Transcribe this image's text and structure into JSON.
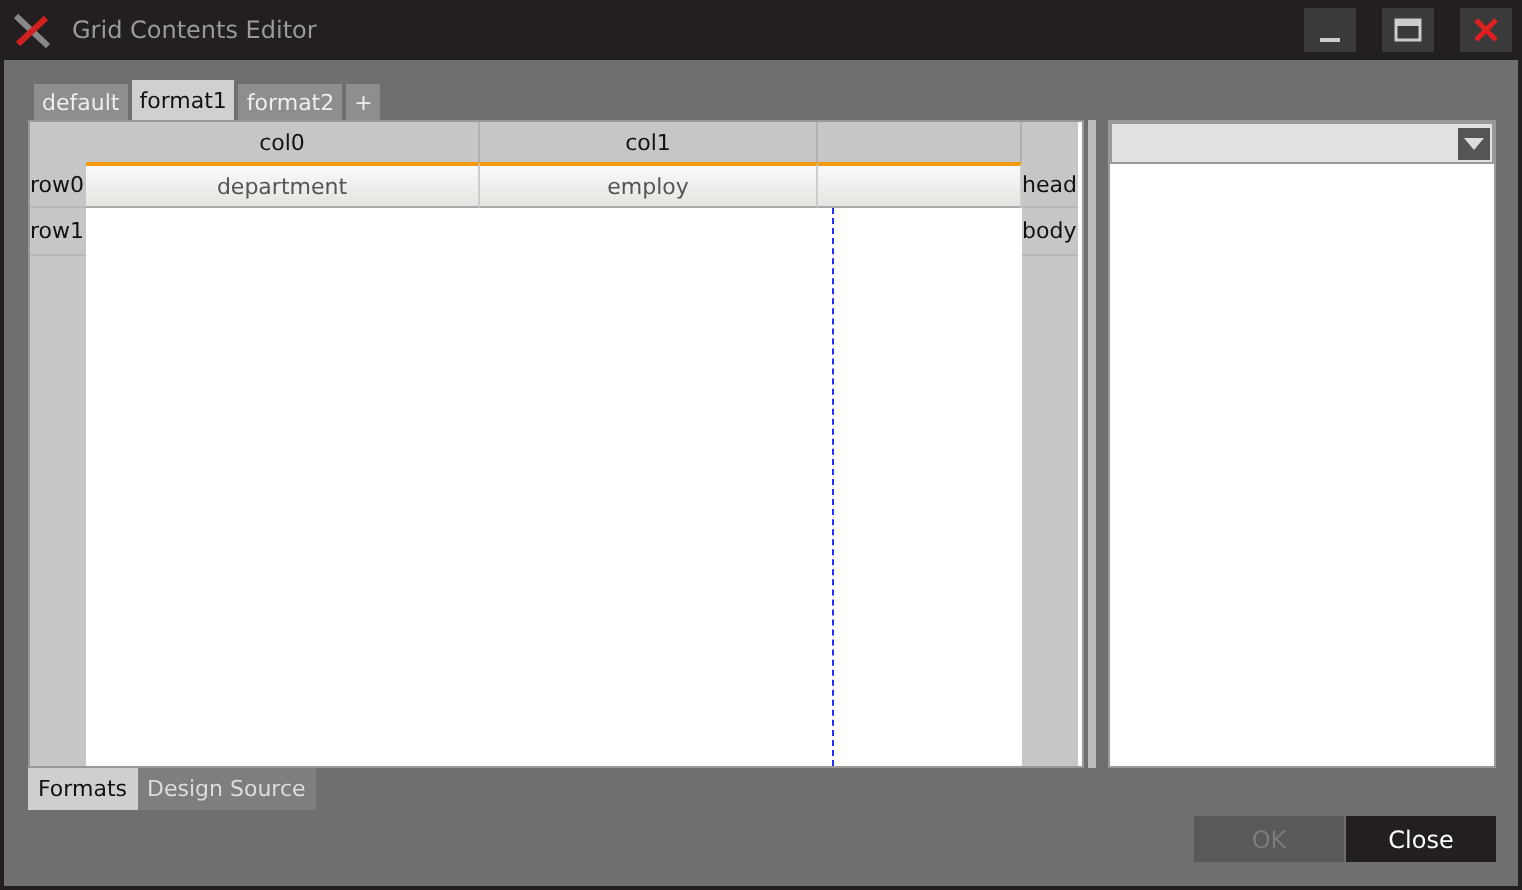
{
  "window": {
    "title": "Grid Contents Editor"
  },
  "tabs": [
    {
      "label": "default",
      "selected": false
    },
    {
      "label": "format1",
      "selected": true
    },
    {
      "label": "format2",
      "selected": false
    },
    {
      "label": "+",
      "selected": false
    }
  ],
  "grid": {
    "columns": [
      "col0",
      "col1"
    ],
    "rows": [
      {
        "label": "row0",
        "cells": [
          "department",
          "employ"
        ]
      },
      {
        "label": "row1",
        "cells": []
      }
    ],
    "sections": [
      "head",
      "body"
    ]
  },
  "bottom_tabs": [
    {
      "label": "Formats",
      "selected": true
    },
    {
      "label": "Design Source",
      "selected": false
    }
  ],
  "buttons": [
    {
      "label": "OK",
      "disabled": true
    },
    {
      "label": "Close",
      "disabled": false
    }
  ]
}
